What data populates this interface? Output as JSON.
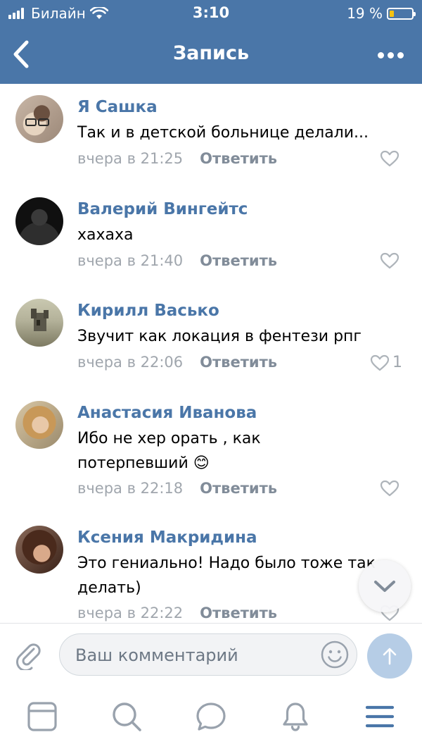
{
  "status_bar": {
    "carrier": "Билайн",
    "time": "3:10",
    "battery": "19 %"
  },
  "header": {
    "title": "Запись"
  },
  "comments": [
    {
      "author": "Я Сашка",
      "text": "Так и в детской больнице делали...",
      "time": "вчера в 21:25",
      "reply": "Ответить",
      "likes": ""
    },
    {
      "author": "Валерий Вингейтс",
      "text": "хахаха",
      "time": "вчера в 21:40",
      "reply": "Ответить",
      "likes": ""
    },
    {
      "author": "Кирилл Васько",
      "text": "Звучит как локация в фентези рпг",
      "time": "вчера в 22:06",
      "reply": "Ответить",
      "likes": "1"
    },
    {
      "author": "Анастасия Иванова",
      "text": "Ибо не хер орать , как потерпевший 😊",
      "time": "вчера в 22:18",
      "reply": "Ответить",
      "likes": ""
    },
    {
      "author": "Ксения Макридина",
      "text": "Это гениально! Надо было тоже так делать)",
      "time": "вчера в 22:22",
      "reply": "Ответить",
      "likes": ""
    }
  ],
  "composer": {
    "placeholder": "Ваш комментарий",
    "value": ""
  },
  "colors": {
    "brand": "#4a76a8",
    "author": "#4a76a8",
    "muted": "#a0a6ad",
    "send_button": "#b6cde6"
  },
  "icons": {
    "back": "chevron-left-icon",
    "more": "more-dots-icon",
    "like": "heart-outline-icon",
    "scroll": "chevron-down-icon",
    "attach": "paperclip-icon",
    "emoji": "smile-icon",
    "send": "arrow-up-icon",
    "tabs": [
      "news-icon",
      "search-icon",
      "messages-icon",
      "notifications-icon",
      "menu-icon"
    ]
  }
}
